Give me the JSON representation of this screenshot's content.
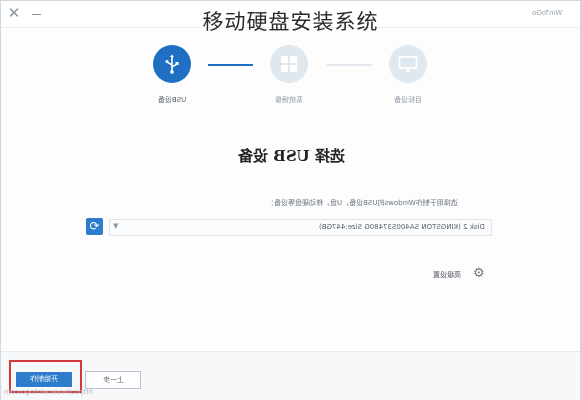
{
  "window": {
    "app_name": "WinToGo"
  },
  "overlay": {
    "title": "移动硬盘安装系统"
  },
  "steps": [
    {
      "label": "USB设备",
      "icon": "usb-icon",
      "state": "active"
    },
    {
      "label": "系统镜像",
      "icon": "windows-icon",
      "state": "inactive"
    },
    {
      "label": "目标设备",
      "icon": "monitor-icon",
      "state": "inactive"
    }
  ],
  "main": {
    "heading": "选择 USB 设备",
    "instruction": "选择用于制作Windows的USB设备，U盘，移动硬盘等设备：",
    "disk": {
      "selected": "Disk 2 (KINGSTON SA400S37480G   Size:447GB)"
    },
    "advanced_label": "高级设置"
  },
  "footer": {
    "start_label": "开始制作",
    "prev_label": "上一步",
    "watermark": "https://www.wintogo.com"
  },
  "colors": {
    "accent": "#1f6fc4",
    "highlight": "#d23a3a",
    "inactive_step": "#dfe7ef"
  }
}
